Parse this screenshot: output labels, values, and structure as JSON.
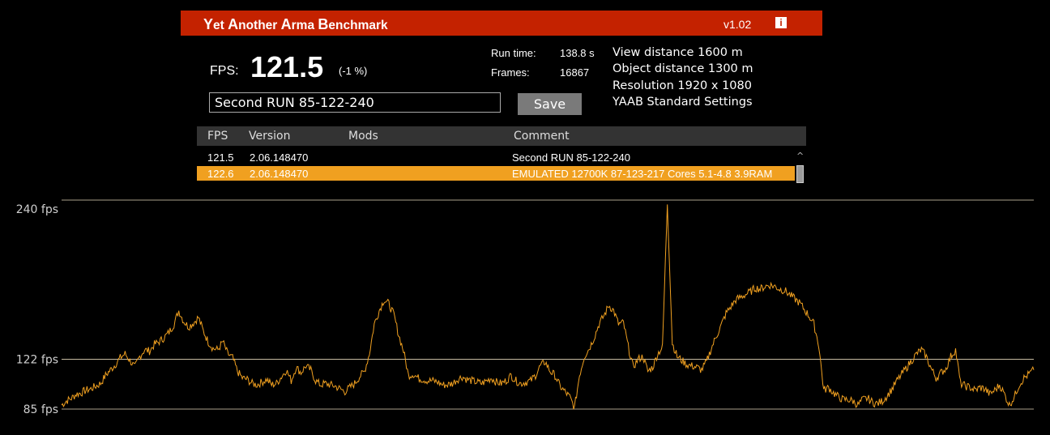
{
  "app": {
    "title_parts": [
      {
        "cap": "Y",
        "rest": "et "
      },
      {
        "cap": "A",
        "rest": "nother "
      },
      {
        "cap": "A",
        "rest": "rma "
      },
      {
        "cap": "B",
        "rest": "enchmark"
      }
    ],
    "version": "v1.02",
    "info_icon": "info-icon",
    "accent_color": "#c42200"
  },
  "result": {
    "fps_label": "FPS:",
    "fps_value": "121.5",
    "fps_delta": "(-1 %)",
    "run_time_label": "Run time:",
    "run_time_value": "138.8 s",
    "frames_label": "Frames:",
    "frames_value": "16867"
  },
  "settings": [
    "View distance 1600 m",
    "Object distance 1300 m",
    "Resolution 1920 x 1080",
    "YAAB Standard Settings"
  ],
  "comment": {
    "value": "Second RUN 85-122-240",
    "save_label": "Save"
  },
  "table": {
    "headers": [
      "FPS",
      "Version",
      "Mods",
      "Comment"
    ],
    "rows": [
      {
        "fps": "121.5",
        "version": "2.06.148470",
        "mods": "",
        "comment": "Second RUN 85-122-240",
        "selected": false
      },
      {
        "fps": "122.6",
        "version": "2.06.148470",
        "mods": "",
        "comment": "EMULATED 12700K 87-123-217 Cores 5.1-4.8 3.9RAM",
        "selected": true
      }
    ],
    "scroll_up_glyph": "^",
    "selected_color": "#f0a020"
  },
  "chart_data": {
    "type": "line",
    "title": "",
    "xlabel": "",
    "ylabel": "",
    "reference_lines": [
      {
        "value": 240,
        "label": "240 fps"
      },
      {
        "value": 122,
        "label": "122 fps"
      },
      {
        "value": 85,
        "label": "85 fps"
      }
    ],
    "line_color": "#f0a020",
    "series": [
      {
        "values": [
          88,
          91,
          93,
          96,
          97,
          99,
          100,
          102,
          104,
          110,
          114,
          118,
          123,
          126,
          121,
          116,
          124,
          129,
          128,
          133,
          135,
          138,
          142,
          148,
          158,
          150,
          146,
          149,
          153,
          143,
          135,
          130,
          129,
          135,
          126,
          123,
          113,
          108,
          107,
          104,
          103,
          105,
          107,
          103,
          104,
          109,
          114,
          106,
          116,
          112,
          117,
          114,
          106,
          103,
          104,
          103,
          102,
          100,
          98,
          101,
          104,
          109,
          113,
          126,
          148,
          158,
          166,
          163,
          155,
          140,
          128,
          110,
          111,
          108,
          107,
          106,
          106,
          105,
          103,
          103,
          104,
          107,
          109,
          107,
          106,
          105,
          104,
          106,
          108,
          105,
          104,
          106,
          110,
          106,
          104,
          105,
          106,
          110,
          117,
          120,
          113,
          110,
          102,
          98,
          94,
          86,
          110,
          124,
          130,
          138,
          148,
          154,
          162,
          158,
          148,
          149,
          131,
          116,
          122,
          124,
          113,
          116,
          126,
          131,
          238,
          134,
          124,
          121,
          118,
          117,
          116,
          114,
          120,
          130,
          139,
          147,
          156,
          161,
          166,
          168,
          170,
          172,
          175,
          174,
          176,
          177,
          176,
          174,
          173,
          170,
          167,
          164,
          159,
          154,
          148,
          132,
          99,
          101,
          97,
          94,
          92,
          92,
          91,
          88,
          92,
          93,
          90,
          89,
          91,
          95,
          100,
          106,
          111,
          116,
          121,
          126,
          129,
          124,
          115,
          108,
          112,
          115,
          124,
          129,
          104,
          102,
          101,
          99,
          101,
          100,
          96,
          99,
          103,
          96,
          88,
          94,
          103,
          108,
          111,
          114
        ]
      }
    ]
  }
}
